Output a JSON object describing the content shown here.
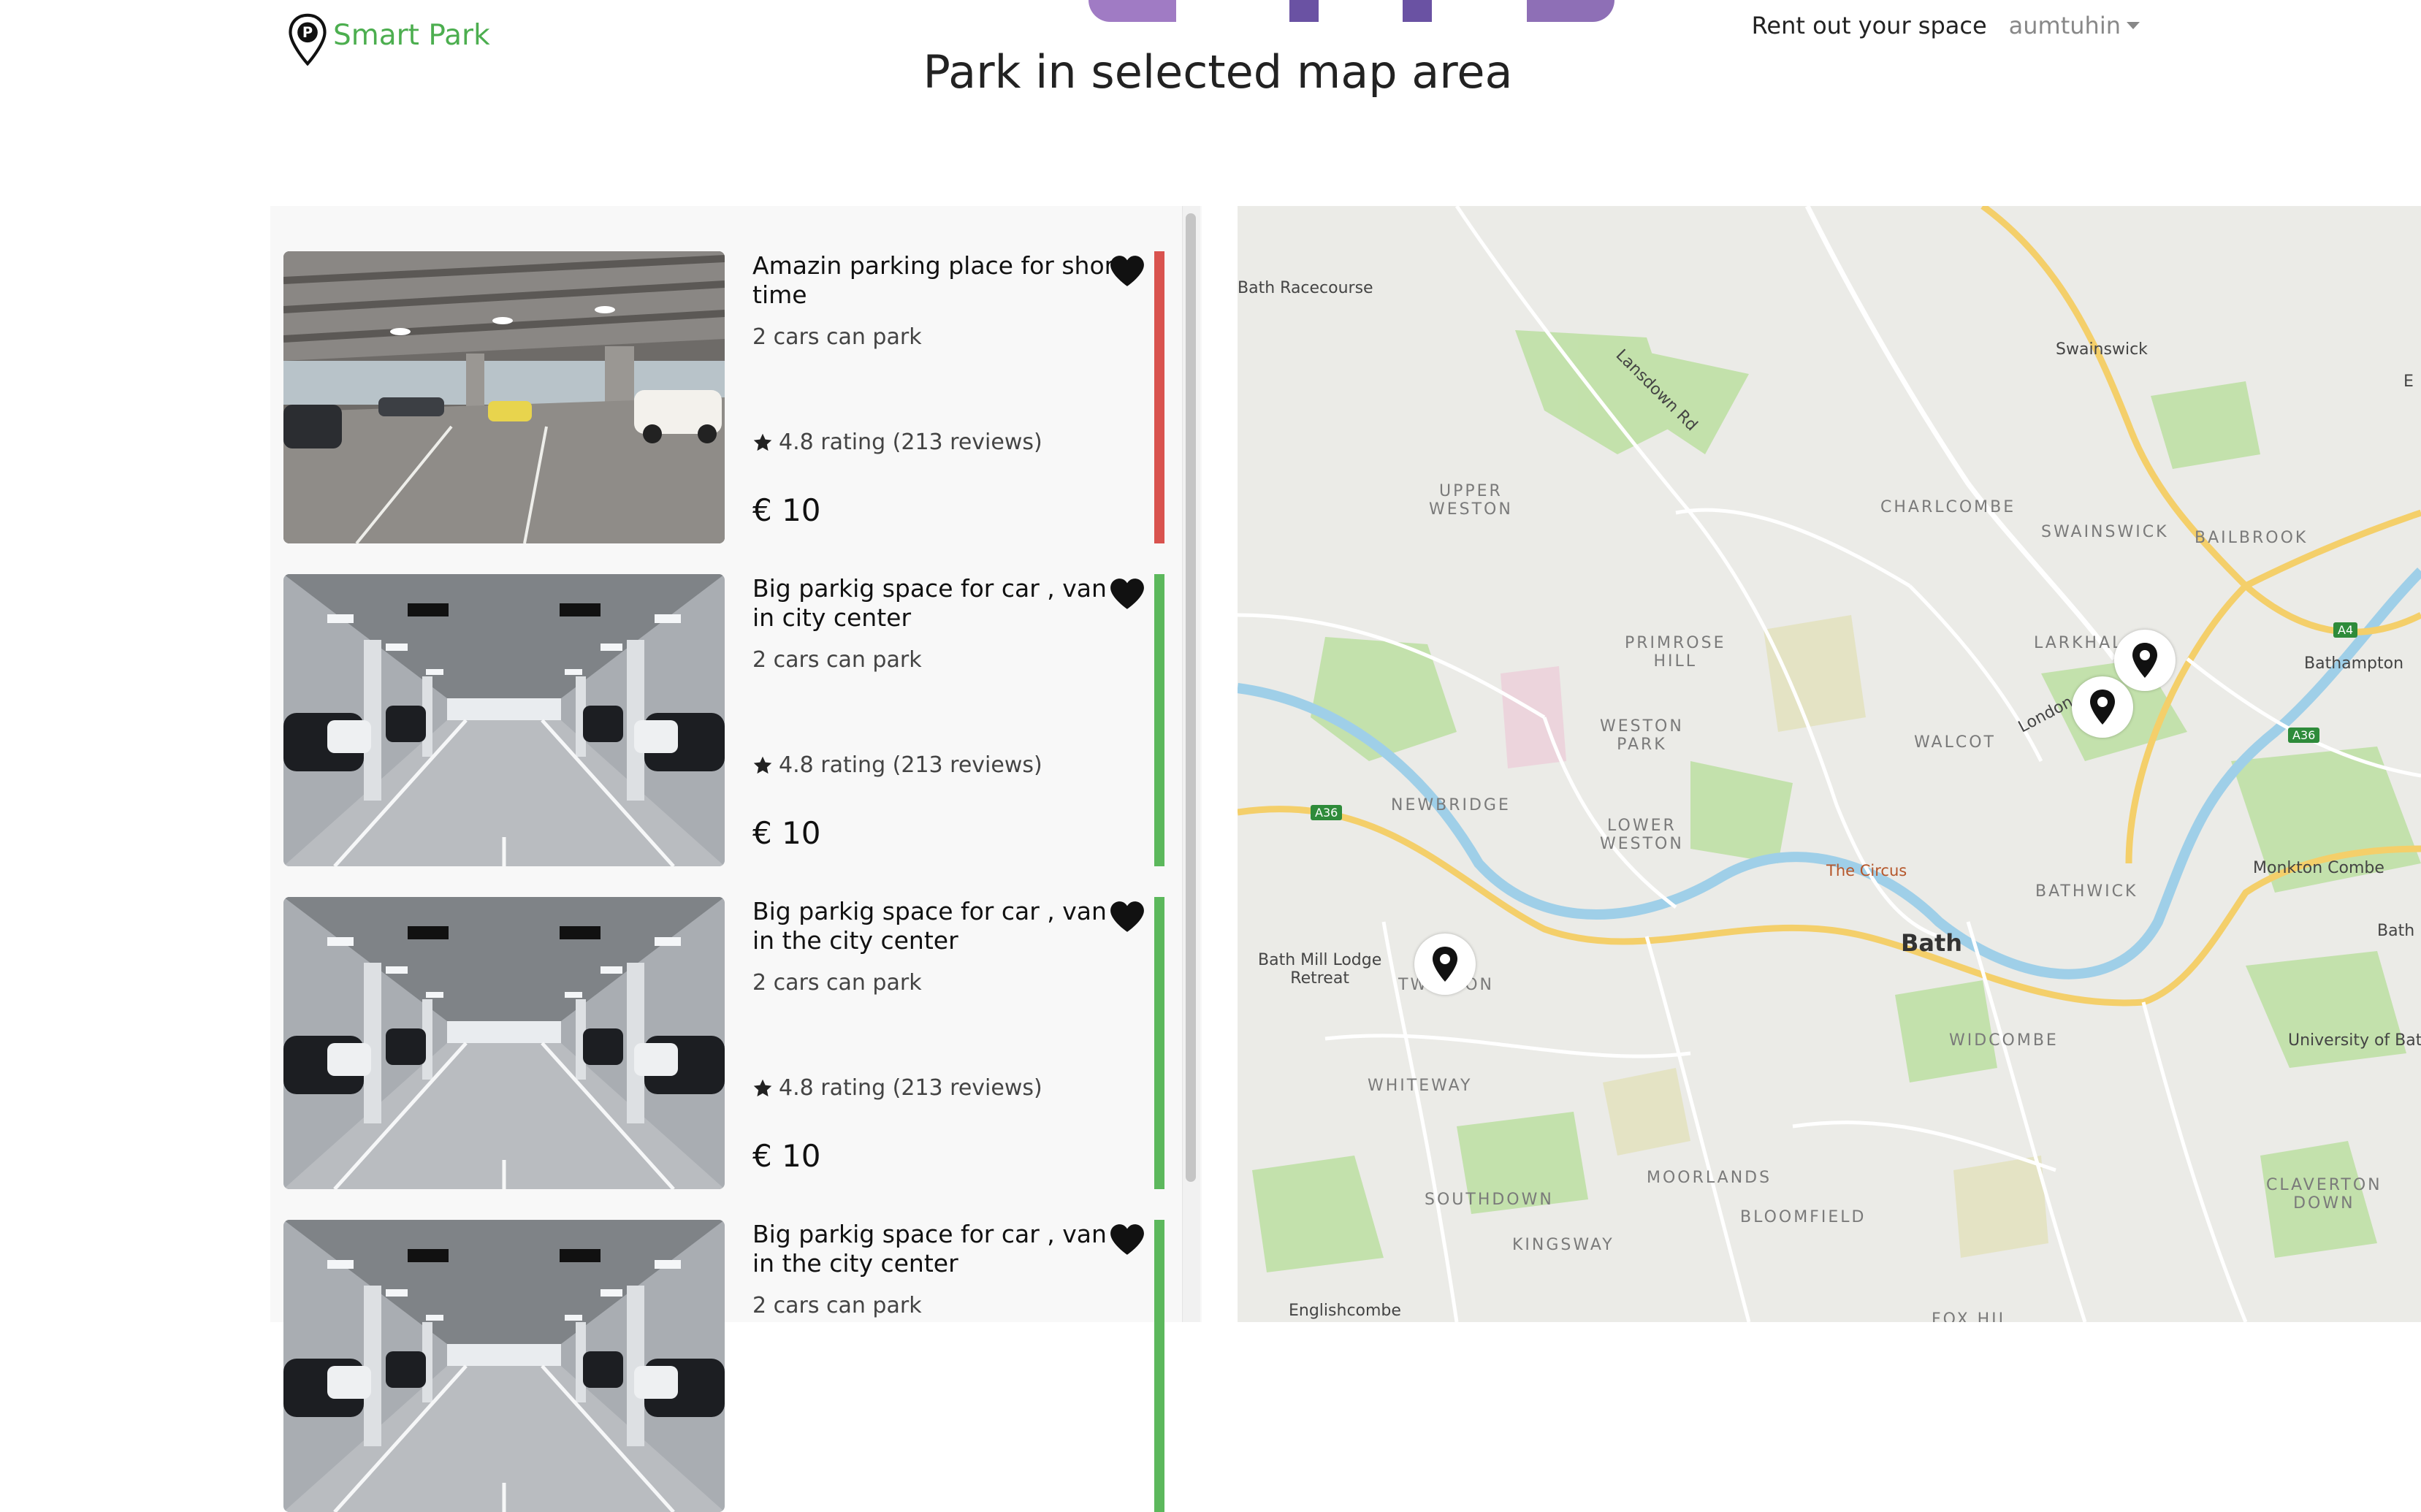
{
  "brand": {
    "name": "Smart Park"
  },
  "nav": {
    "rent_label": "Rent out your space",
    "user_label": "aumtuhin"
  },
  "page_title": "Park in selected map area",
  "listings": [
    {
      "title": "Amazin parking place for short time",
      "capacity": "2 cars can park",
      "rating_text": "4.8 rating (213 reviews)",
      "price": "€ 10",
      "availability_color": "#d9534f",
      "photo": "garage-open"
    },
    {
      "title": "Big parkig space for car , van in city center",
      "capacity": "2 cars can park",
      "rating_text": "4.8 rating (213 reviews)",
      "price": "€ 10",
      "availability_color": "#5cb85c",
      "photo": "garage-indoor"
    },
    {
      "title": "Big parkig space for car , van in the city center",
      "capacity": "2 cars can park",
      "rating_text": "4.8 rating (213 reviews)",
      "price": "€ 10",
      "availability_color": "#5cb85c",
      "photo": "garage-indoor"
    },
    {
      "title": "Big parkig space for car , van in the city center",
      "capacity": "2 cars can park",
      "rating_text": "",
      "price": "",
      "availability_color": "#5cb85c",
      "photo": "garage-indoor"
    }
  ],
  "map": {
    "labels": {
      "racecourse": "Bath Racecourse",
      "swainswick": "Swainswick",
      "lansdown": "Lansdown Rd",
      "upper_weston": "UPPER\nWESTON",
      "charlcombe": "CHARLCOMBE",
      "swainswick_d": "SWAINSWICK",
      "bailbrook": "BAILBROOK",
      "larkhall": "LARKHAL",
      "bathampton": "Bathampton",
      "primrose": "PRIMROSE\nHILL",
      "weston_park": "WESTON\nPARK",
      "walcot": "WALCOT",
      "london_rd": "London",
      "newbridge": "NEWBRIDGE",
      "lower_weston": "LOWER\nWESTON",
      "circus": "The Circus",
      "monkton": "Monkton Combe",
      "bathwick": "BATHWICK",
      "mill_lodge": "Bath Mill Lodge\nRetreat",
      "twerton": "TWERTON",
      "bath": "Bath",
      "bath_edge": "Bath",
      "widcombe": "WIDCOMBE",
      "university": "University of Bat",
      "whiteway": "WHITEWAY",
      "southdown": "SOUTHDOWN",
      "moorlands": "MOORLANDS",
      "bloomfield": "BLOOMFIELD",
      "claverton": "CLAVERTON\nDOWN",
      "kingsway": "KINGSWAY",
      "englishcombe": "Englishcombe",
      "foxhill": "FOX HIL",
      "edge_e": "E"
    },
    "shields": {
      "a36_left": "A36",
      "a4": "A4",
      "a36_right": "A36"
    },
    "markers": [
      "map-marker-larkhall",
      "map-marker-london-road",
      "map-marker-twerton"
    ]
  }
}
